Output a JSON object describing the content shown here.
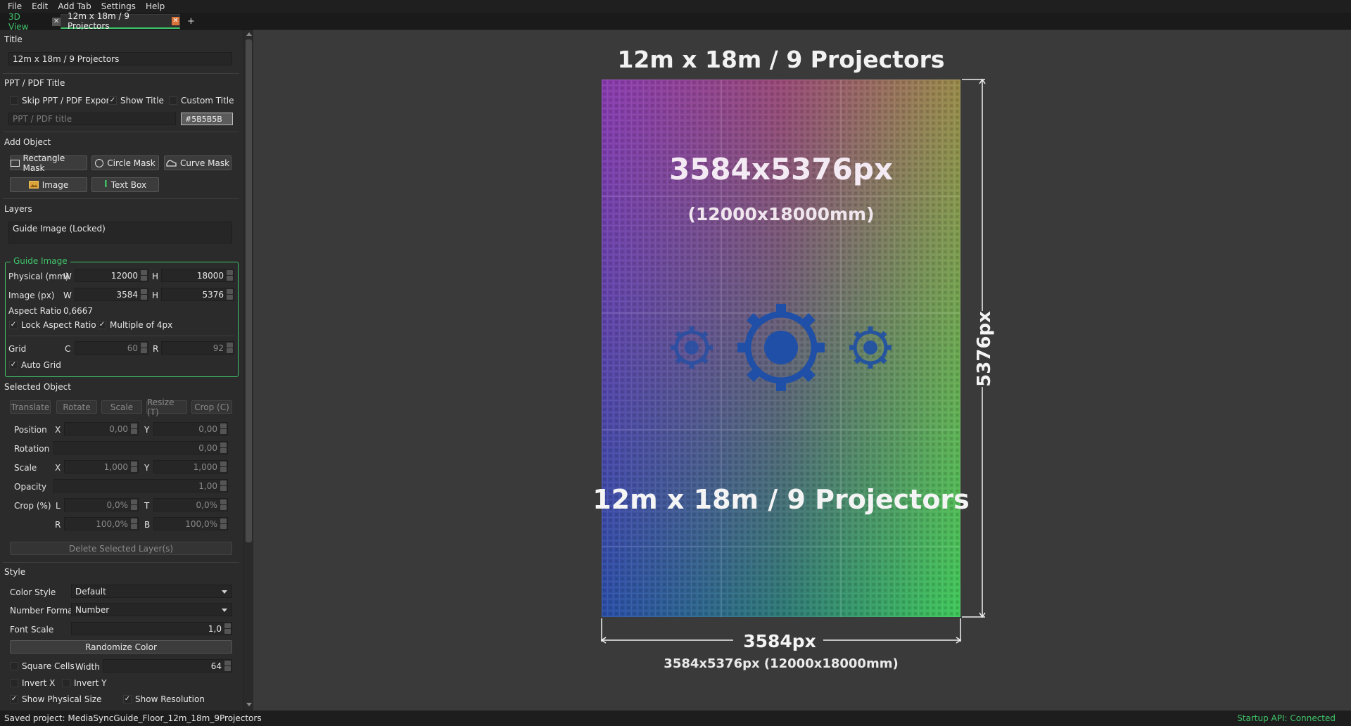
{
  "menu": [
    "File",
    "Edit",
    "Add Tab",
    "Settings",
    "Help"
  ],
  "tabs": [
    {
      "label": "3D View"
    },
    {
      "label": "12m x 18m / 9 Projectors"
    }
  ],
  "add_tab_symbol": "+",
  "panel": {
    "title_section": "Title",
    "title_value": "12m x 18m / 9 Projectors",
    "ppt_section": "PPT / PDF Title",
    "skip_export": "Skip PPT / PDF Export",
    "show_title": "Show Title",
    "custom_title": "Custom Title",
    "ppt_placeholder": "PPT / PDF title",
    "ppt_color": "#5B5B5B",
    "add_object_section": "Add Object",
    "btn_rect": "Rectangle Mask",
    "btn_circle": "Circle Mask",
    "btn_curve": "Curve Mask",
    "btn_image": "Image",
    "btn_textbox": "Text Box",
    "layers_section": "Layers",
    "layer_item": "Guide Image (Locked)",
    "guide_section": "Guide Image",
    "physical_label": "Physical (mm)",
    "w_label": "W",
    "h_label": "H",
    "physical_w": "12000",
    "physical_h": "18000",
    "image_label": "Image (px)",
    "image_w": "3584",
    "image_h": "5376",
    "aspect_label": "Aspect Ratio",
    "aspect_value": "0,6667",
    "lock_aspect": "Lock Aspect Ratio",
    "multiple4": "Multiple of 4px",
    "grid_label": "Grid",
    "c_label": "C",
    "r_label": "R",
    "grid_c": "60",
    "grid_r": "92",
    "auto_grid": "Auto Grid",
    "selected_section": "Selected Object",
    "mode_translate": "Translate",
    "mode_rotate": "Rotate",
    "mode_scale": "Scale",
    "mode_resize": "Resize (T)",
    "mode_crop": "Crop (C)",
    "position_label": "Position",
    "x_label": "X",
    "y_label": "Y",
    "pos_x": "0,00",
    "pos_y": "0,00",
    "rotation_label": "Rotation",
    "rotation": "0,00",
    "scale_label": "Scale",
    "scale_x": "1,000",
    "scale_y": "1,000",
    "opacity_label": "Opacity",
    "opacity": "1,00",
    "crop_label": "Crop (%)",
    "l_label": "L",
    "t_label": "T",
    "b_label": "B",
    "crop_l": "0,0%",
    "crop_t": "0,0%",
    "crop_r": "100,0%",
    "crop_b": "100,0%",
    "delete_btn": "Delete Selected Layer(s)",
    "style_section": "Style",
    "color_style_label": "Color Style",
    "color_style": "Default",
    "number_format_label": "Number Format",
    "number_format": "Number",
    "font_scale_label": "Font Scale",
    "font_scale": "1,0",
    "randomize_btn": "Randomize Color",
    "square_cells": "Square Cells",
    "width_label": "Width",
    "width_value": "64",
    "invert_x": "Invert X",
    "invert_y": "Invert Y",
    "show_physical": "Show Physical Size",
    "show_resolution": "Show Resolution"
  },
  "canvas": {
    "heading": "12m x 18m / 9 Projectors",
    "res_text": "3584x5376px",
    "mm_text": "(12000x18000mm)",
    "bottom_title": "12m x 18m / 9 Projectors",
    "width_dim": "3584px",
    "height_dim": "5376px",
    "caption": "3584x5376px (12000x18000mm)"
  },
  "status": {
    "left": "Saved project: MediaSyncGuide_Floor_12m_18m_9Projectors",
    "right": "Startup API: Connected"
  },
  "colors": {
    "accent_green": "#3fc46a",
    "tab_close_orange": "#d9733a"
  }
}
